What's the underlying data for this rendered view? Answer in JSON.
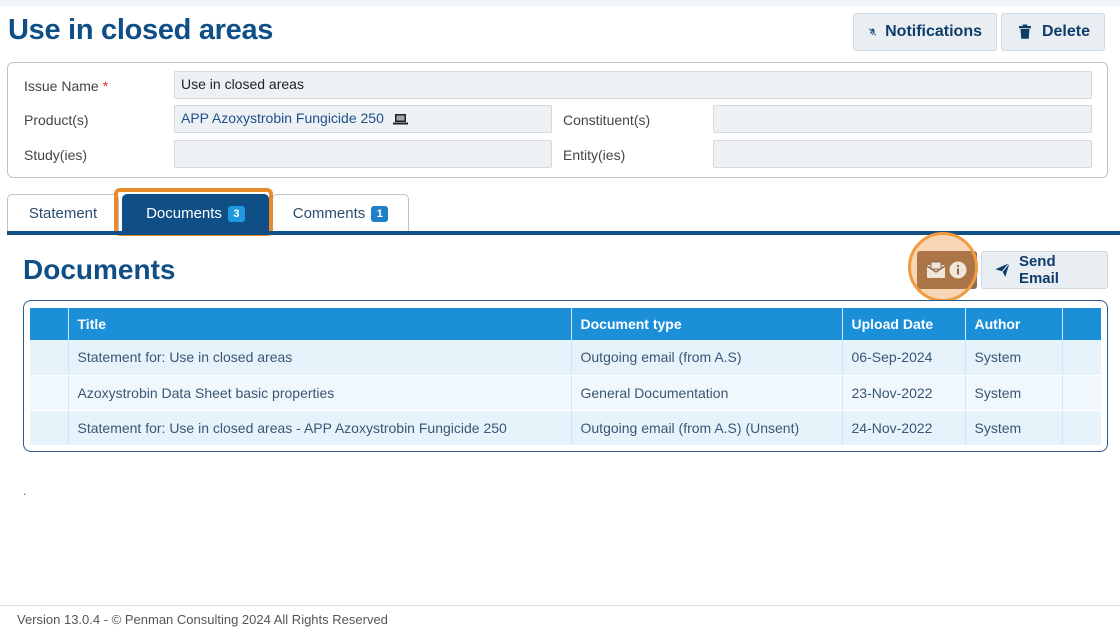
{
  "page": {
    "title": "Use in closed areas"
  },
  "header_actions": {
    "notifications_label": "Notifications",
    "delete_label": "Delete"
  },
  "issue": {
    "name_label": "Issue Name",
    "required_mark": "*",
    "name_value": "Use in closed areas",
    "products_label": "Product(s)",
    "products_value": "APP Azoxystrobin Fungicide 250",
    "constituents_label": "Constituent(s)",
    "constituents_value": "",
    "studies_label": "Study(ies)",
    "studies_value": "",
    "entities_label": "Entity(ies)",
    "entities_value": ""
  },
  "tabs": [
    {
      "label": "Statement",
      "badge": ""
    },
    {
      "label": "Documents",
      "badge": "3"
    },
    {
      "label": "Comments",
      "badge": "1"
    }
  ],
  "documents": {
    "title": "Documents",
    "send_email_label": "Send Email",
    "columns": [
      "",
      "Title",
      "Document type",
      "Upload Date",
      "Author",
      ""
    ],
    "rows": [
      {
        "title": "Statement for: Use in closed areas",
        "type": "Outgoing email (from A.S)",
        "date": "06-Sep-2024",
        "author": "System"
      },
      {
        "title": "Azoxystrobin Data Sheet basic properties",
        "type": "General Documentation",
        "date": "23-Nov-2022",
        "author": "System"
      },
      {
        "title": "Statement for: Use in closed areas - APP Azoxystrobin Fungicide 250",
        "type": "Outgoing email (from A.S)  (Unsent)",
        "date": "24-Nov-2022",
        "author": "System"
      }
    ]
  },
  "misc": {
    "dot": "."
  },
  "footer": {
    "text": "Version 13.0.4 - © Penman Consulting 2024 All Rights Reserved"
  },
  "colors": {
    "brand_navy": "#0f4f86",
    "table_header": "#1b8fd8",
    "highlight_orange": "#e98a2d"
  },
  "icons": [
    "bell-slash-icon",
    "trash-icon",
    "laptop-icon",
    "email-info-icon",
    "paper-plane-icon"
  ]
}
